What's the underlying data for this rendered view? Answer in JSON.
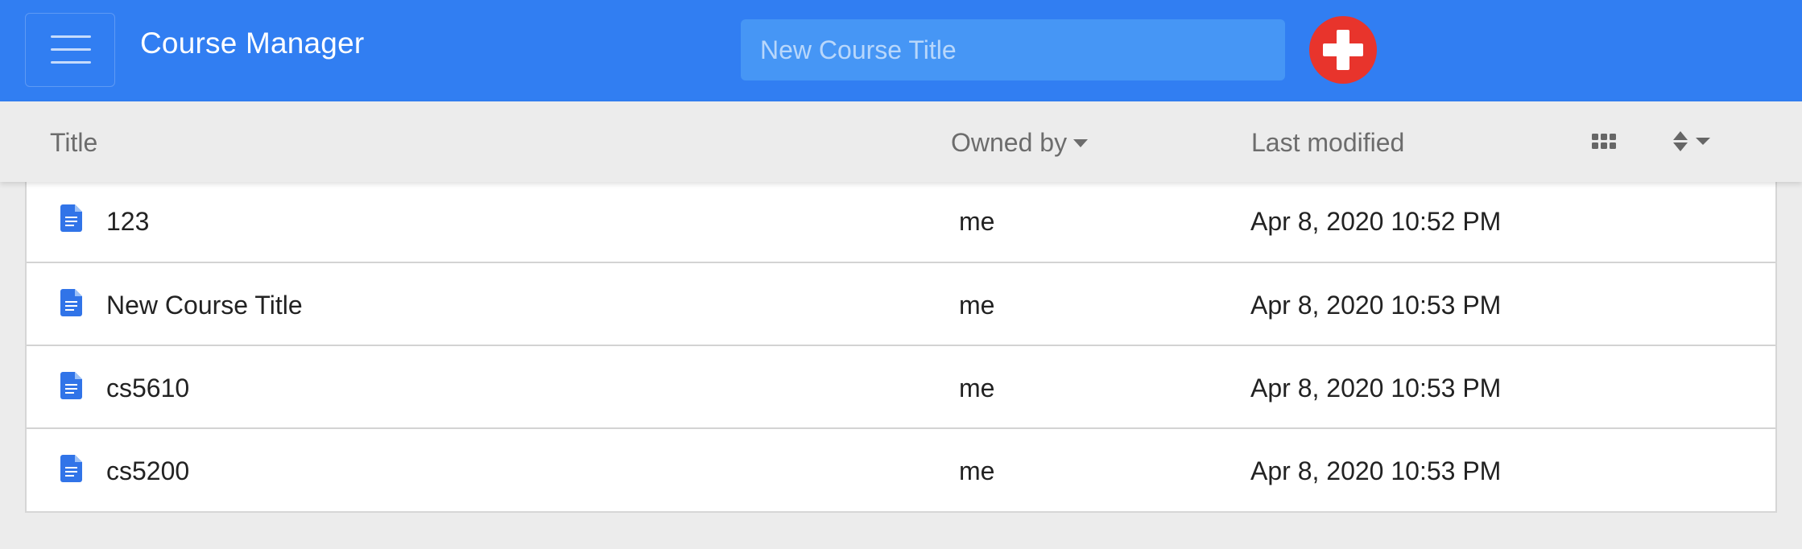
{
  "header": {
    "app_title": "Course Manager",
    "new_course_placeholder": "New Course Title"
  },
  "table": {
    "columns": {
      "title": "Title",
      "owned_by": "Owned by",
      "last_modified": "Last modified"
    },
    "rows": [
      {
        "title": "123",
        "owner": "me",
        "modified": "Apr 8, 2020 10:52 PM"
      },
      {
        "title": "New Course Title",
        "owner": "me",
        "modified": "Apr 8, 2020 10:53 PM"
      },
      {
        "title": "cs5610",
        "owner": "me",
        "modified": "Apr 8, 2020 10:53 PM"
      },
      {
        "title": "cs5200",
        "owner": "me",
        "modified": "Apr 8, 2020 10:53 PM"
      }
    ]
  },
  "icons": {
    "menu": "hamburger-icon",
    "add": "plus-icon",
    "row": "document-icon",
    "grid": "grid-view-icon",
    "sort": "sort-icon",
    "owned_caret": "caret-down-icon"
  },
  "colors": {
    "topbar": "#317ef2",
    "input_bg": "#4696f5",
    "add_button": "#e8342c",
    "doc_icon": "#3174e8",
    "page_bg": "#ececec"
  }
}
